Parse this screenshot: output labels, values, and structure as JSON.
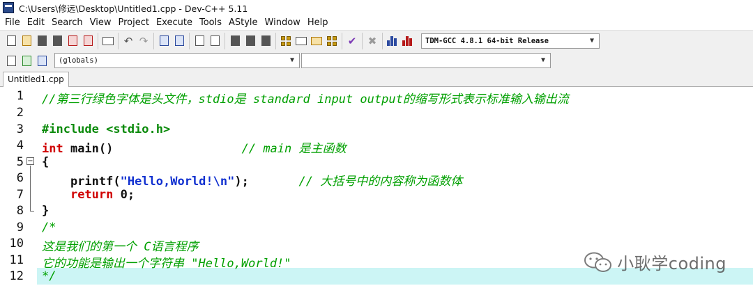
{
  "window": {
    "title": "C:\\Users\\修远\\Desktop\\Untitled1.cpp - Dev-C++ 5.11"
  },
  "menu": [
    "File",
    "Edit",
    "Search",
    "View",
    "Project",
    "Execute",
    "Tools",
    "AStyle",
    "Window",
    "Help"
  ],
  "toolbar": {
    "compiler": "TDM-GCC 4.8.1 64-bit Release",
    "scope": "(globals)",
    "member": ""
  },
  "tabs": [
    "Untitled1.cpp"
  ],
  "editor": {
    "line_numbers": [
      "1",
      "2",
      "3",
      "4",
      "5",
      "6",
      "7",
      "8",
      "9",
      "10",
      "11",
      "12"
    ],
    "highlighted_line": 12,
    "lines": {
      "l1": "//第三行绿色字体是头文件，stdio是 standard input output的缩写形式表示标准输入输出流",
      "l3": "#include <stdio.h>",
      "l4_kw": "int",
      "l4_name": " main()",
      "l4_pad": "                  ",
      "l4_comment": "// main 是主函数",
      "l5": "{",
      "l6_pre": "    printf(",
      "l6_str": "\"Hello,World!\\n\"",
      "l6_post": ");",
      "l6_pad": "       ",
      "l6_comment": "// 大括号中的内容称为函数体",
      "l7_pre": "    ",
      "l7_kw": "return",
      "l7_post": " 0;",
      "l8": "}",
      "l9": "/*",
      "l10": "这是我们的第一个 C语言程序",
      "l11": "它的功能是输出一个字符串 \"Hello,World!\"",
      "l12": "*/"
    }
  },
  "watermark": "小耿学coding"
}
